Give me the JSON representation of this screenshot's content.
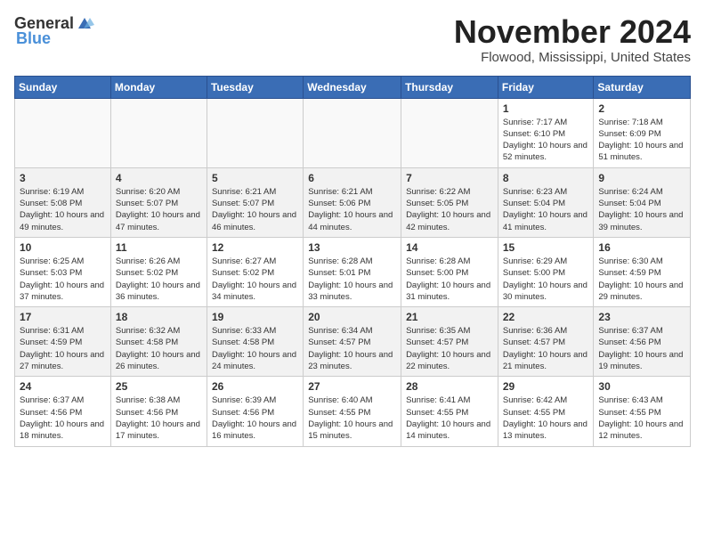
{
  "header": {
    "logo_general": "General",
    "logo_blue": "Blue",
    "month_title": "November 2024",
    "location": "Flowood, Mississippi, United States"
  },
  "weekdays": [
    "Sunday",
    "Monday",
    "Tuesday",
    "Wednesday",
    "Thursday",
    "Friday",
    "Saturday"
  ],
  "rows": [
    {
      "cells": [
        {
          "empty": true
        },
        {
          "empty": true
        },
        {
          "empty": true
        },
        {
          "empty": true
        },
        {
          "empty": true
        },
        {
          "day": "1",
          "sunrise": "Sunrise: 7:17 AM",
          "sunset": "Sunset: 6:10 PM",
          "daylight": "Daylight: 10 hours and 52 minutes."
        },
        {
          "day": "2",
          "sunrise": "Sunrise: 7:18 AM",
          "sunset": "Sunset: 6:09 PM",
          "daylight": "Daylight: 10 hours and 51 minutes."
        }
      ]
    },
    {
      "cells": [
        {
          "day": "3",
          "sunrise": "Sunrise: 6:19 AM",
          "sunset": "Sunset: 5:08 PM",
          "daylight": "Daylight: 10 hours and 49 minutes."
        },
        {
          "day": "4",
          "sunrise": "Sunrise: 6:20 AM",
          "sunset": "Sunset: 5:07 PM",
          "daylight": "Daylight: 10 hours and 47 minutes."
        },
        {
          "day": "5",
          "sunrise": "Sunrise: 6:21 AM",
          "sunset": "Sunset: 5:07 PM",
          "daylight": "Daylight: 10 hours and 46 minutes."
        },
        {
          "day": "6",
          "sunrise": "Sunrise: 6:21 AM",
          "sunset": "Sunset: 5:06 PM",
          "daylight": "Daylight: 10 hours and 44 minutes."
        },
        {
          "day": "7",
          "sunrise": "Sunrise: 6:22 AM",
          "sunset": "Sunset: 5:05 PM",
          "daylight": "Daylight: 10 hours and 42 minutes."
        },
        {
          "day": "8",
          "sunrise": "Sunrise: 6:23 AM",
          "sunset": "Sunset: 5:04 PM",
          "daylight": "Daylight: 10 hours and 41 minutes."
        },
        {
          "day": "9",
          "sunrise": "Sunrise: 6:24 AM",
          "sunset": "Sunset: 5:04 PM",
          "daylight": "Daylight: 10 hours and 39 minutes."
        }
      ]
    },
    {
      "cells": [
        {
          "day": "10",
          "sunrise": "Sunrise: 6:25 AM",
          "sunset": "Sunset: 5:03 PM",
          "daylight": "Daylight: 10 hours and 37 minutes."
        },
        {
          "day": "11",
          "sunrise": "Sunrise: 6:26 AM",
          "sunset": "Sunset: 5:02 PM",
          "daylight": "Daylight: 10 hours and 36 minutes."
        },
        {
          "day": "12",
          "sunrise": "Sunrise: 6:27 AM",
          "sunset": "Sunset: 5:02 PM",
          "daylight": "Daylight: 10 hours and 34 minutes."
        },
        {
          "day": "13",
          "sunrise": "Sunrise: 6:28 AM",
          "sunset": "Sunset: 5:01 PM",
          "daylight": "Daylight: 10 hours and 33 minutes."
        },
        {
          "day": "14",
          "sunrise": "Sunrise: 6:28 AM",
          "sunset": "Sunset: 5:00 PM",
          "daylight": "Daylight: 10 hours and 31 minutes."
        },
        {
          "day": "15",
          "sunrise": "Sunrise: 6:29 AM",
          "sunset": "Sunset: 5:00 PM",
          "daylight": "Daylight: 10 hours and 30 minutes."
        },
        {
          "day": "16",
          "sunrise": "Sunrise: 6:30 AM",
          "sunset": "Sunset: 4:59 PM",
          "daylight": "Daylight: 10 hours and 29 minutes."
        }
      ]
    },
    {
      "cells": [
        {
          "day": "17",
          "sunrise": "Sunrise: 6:31 AM",
          "sunset": "Sunset: 4:59 PM",
          "daylight": "Daylight: 10 hours and 27 minutes."
        },
        {
          "day": "18",
          "sunrise": "Sunrise: 6:32 AM",
          "sunset": "Sunset: 4:58 PM",
          "daylight": "Daylight: 10 hours and 26 minutes."
        },
        {
          "day": "19",
          "sunrise": "Sunrise: 6:33 AM",
          "sunset": "Sunset: 4:58 PM",
          "daylight": "Daylight: 10 hours and 24 minutes."
        },
        {
          "day": "20",
          "sunrise": "Sunrise: 6:34 AM",
          "sunset": "Sunset: 4:57 PM",
          "daylight": "Daylight: 10 hours and 23 minutes."
        },
        {
          "day": "21",
          "sunrise": "Sunrise: 6:35 AM",
          "sunset": "Sunset: 4:57 PM",
          "daylight": "Daylight: 10 hours and 22 minutes."
        },
        {
          "day": "22",
          "sunrise": "Sunrise: 6:36 AM",
          "sunset": "Sunset: 4:57 PM",
          "daylight": "Daylight: 10 hours and 21 minutes."
        },
        {
          "day": "23",
          "sunrise": "Sunrise: 6:37 AM",
          "sunset": "Sunset: 4:56 PM",
          "daylight": "Daylight: 10 hours and 19 minutes."
        }
      ]
    },
    {
      "cells": [
        {
          "day": "24",
          "sunrise": "Sunrise: 6:37 AM",
          "sunset": "Sunset: 4:56 PM",
          "daylight": "Daylight: 10 hours and 18 minutes."
        },
        {
          "day": "25",
          "sunrise": "Sunrise: 6:38 AM",
          "sunset": "Sunset: 4:56 PM",
          "daylight": "Daylight: 10 hours and 17 minutes."
        },
        {
          "day": "26",
          "sunrise": "Sunrise: 6:39 AM",
          "sunset": "Sunset: 4:56 PM",
          "daylight": "Daylight: 10 hours and 16 minutes."
        },
        {
          "day": "27",
          "sunrise": "Sunrise: 6:40 AM",
          "sunset": "Sunset: 4:55 PM",
          "daylight": "Daylight: 10 hours and 15 minutes."
        },
        {
          "day": "28",
          "sunrise": "Sunrise: 6:41 AM",
          "sunset": "Sunset: 4:55 PM",
          "daylight": "Daylight: 10 hours and 14 minutes."
        },
        {
          "day": "29",
          "sunrise": "Sunrise: 6:42 AM",
          "sunset": "Sunset: 4:55 PM",
          "daylight": "Daylight: 10 hours and 13 minutes."
        },
        {
          "day": "30",
          "sunrise": "Sunrise: 6:43 AM",
          "sunset": "Sunset: 4:55 PM",
          "daylight": "Daylight: 10 hours and 12 minutes."
        }
      ]
    }
  ]
}
